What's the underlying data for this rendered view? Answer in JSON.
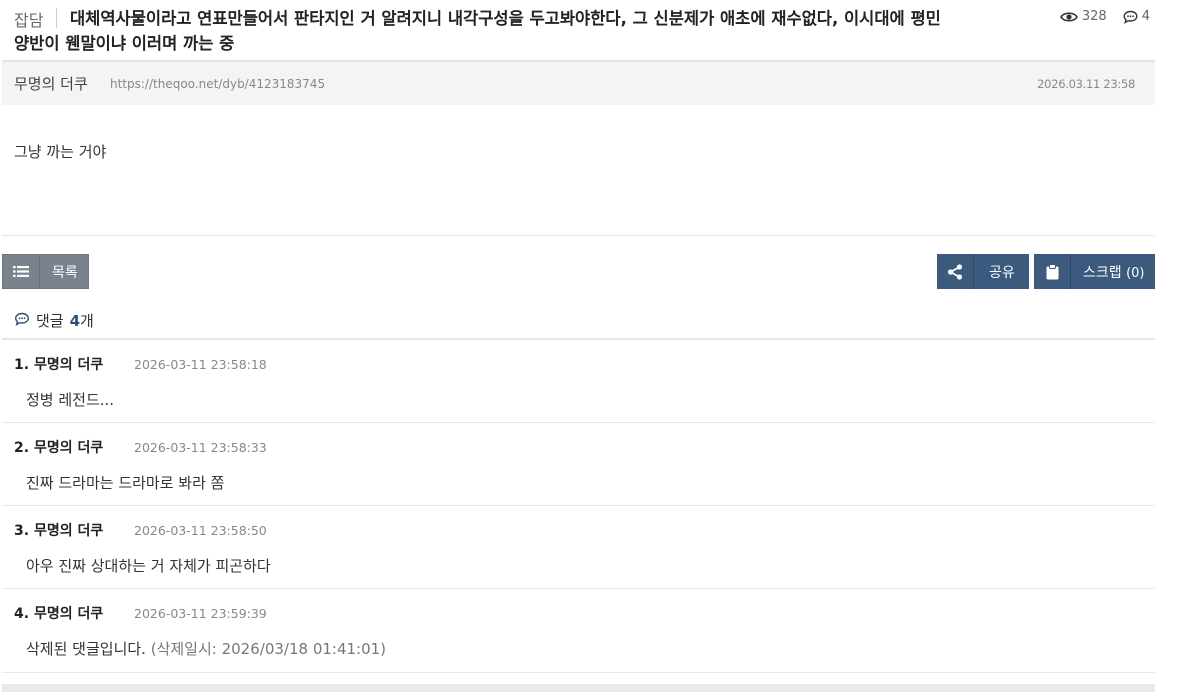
{
  "post": {
    "category": "잡담",
    "title_line1": "대체역사물이라고 연표만들어서 판타지인 거 알려지니 내각구성을 두고봐야한다, 그 신분제가 애초에 재수없다, 이시대에 평민",
    "title_line2": "양반이 웬말이냐 이러며 까는 중",
    "views": "328",
    "comment_count": "4",
    "author": "무명의 더쿠",
    "url": "https://theqoo.net/dyb/4123183745",
    "date": "2026.03.11 23:58",
    "body": "그냥 까는 거야"
  },
  "buttons": {
    "list": "목록",
    "share": "공유",
    "scrap": "스크랩",
    "scrap_count": "(0)"
  },
  "comments_header": {
    "label": "댓글",
    "count": "4",
    "suffix": "개"
  },
  "comments": [
    {
      "num": "1.",
      "author": "무명의 더쿠",
      "time": "2026-03-11 23:58:18",
      "text": "정병 레전드...",
      "note": ""
    },
    {
      "num": "2.",
      "author": "무명의 더쿠",
      "time": "2026-03-11 23:58:33",
      "text": "진짜 드라마는 드라마로 봐라 쫌",
      "note": ""
    },
    {
      "num": "3.",
      "author": "무명의 더쿠",
      "time": "2026-03-11 23:58:50",
      "text": "아우 진짜 상대하는 거 자체가 피곤하다",
      "note": ""
    },
    {
      "num": "4.",
      "author": "무명의 더쿠",
      "time": "2026-03-11 23:59:39",
      "text": "삭제된 댓글입니다.",
      "note": "(삭제일시: 2026/03/18 01:41:01)"
    }
  ],
  "icons": {
    "views": "eye-icon",
    "comments": "speech-bubble-icon",
    "list": "list-icon",
    "share": "share-icon",
    "scrap": "clipboard-icon"
  },
  "colors": {
    "primary_button": "#3b5a7e",
    "list_button": "#7a838d",
    "comment_count": "#2f4f75"
  }
}
